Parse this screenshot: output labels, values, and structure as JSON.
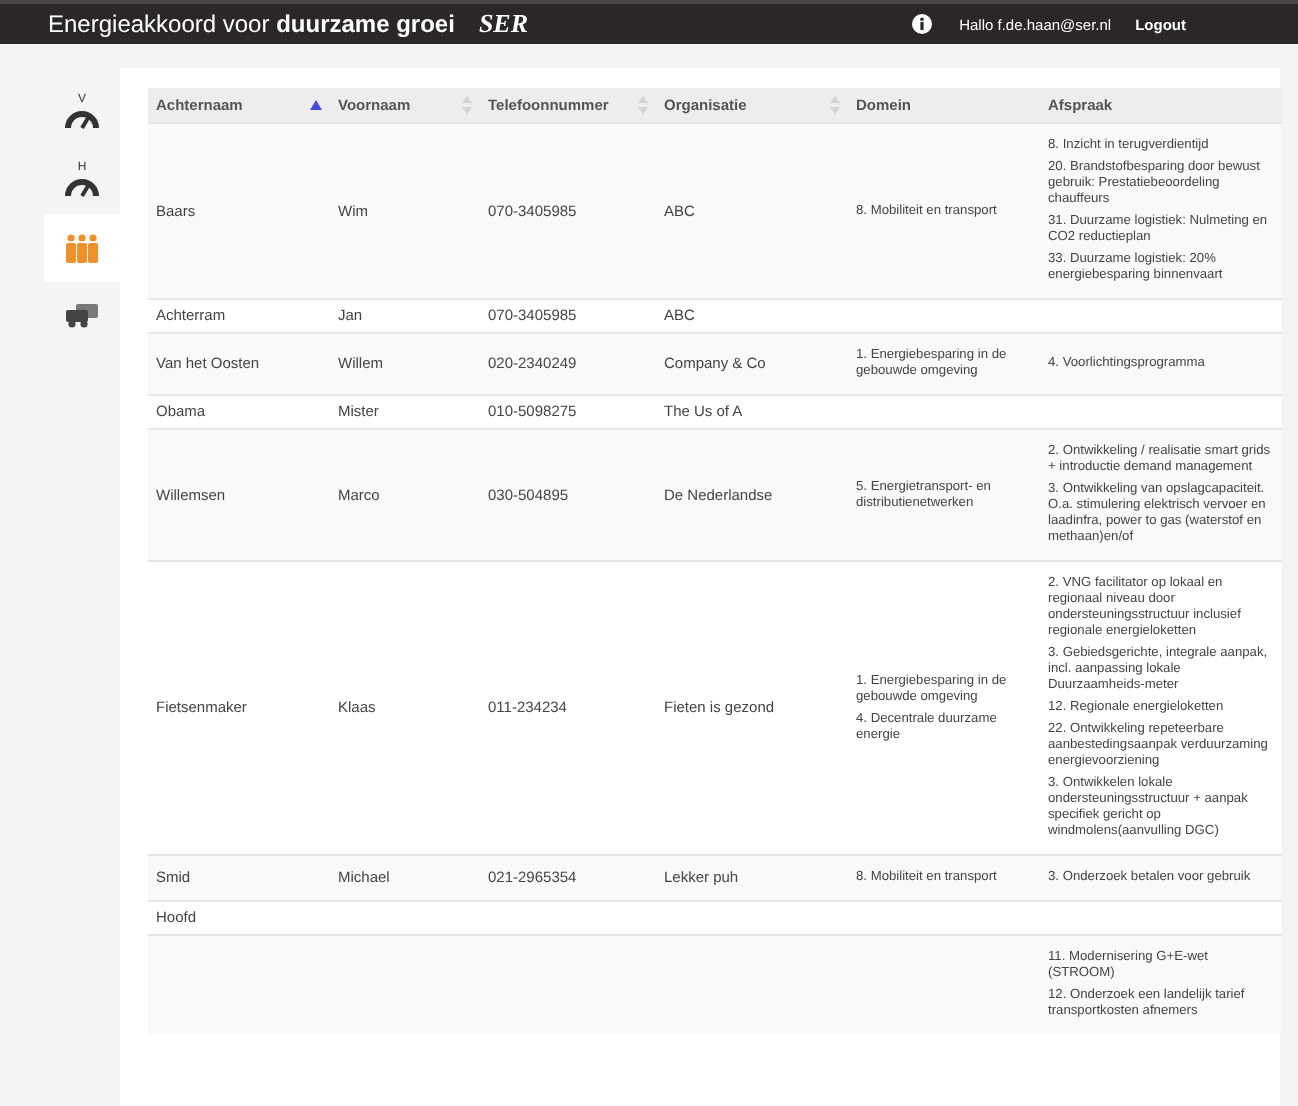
{
  "header": {
    "title_plain": "Energieakkoord voor ",
    "title_bold": "duurzame groei",
    "logo": "SER",
    "greeting": "Hallo f.de.haan@ser.nl",
    "logout": "Logout"
  },
  "sidebar": {
    "items": [
      {
        "kind": "gauge",
        "label": "V",
        "selected": false
      },
      {
        "kind": "gauge",
        "label": "H",
        "selected": false
      },
      {
        "kind": "people",
        "selected": true
      },
      {
        "kind": "vehicles",
        "selected": false
      }
    ]
  },
  "table": {
    "columns": [
      {
        "label": "Achternaam",
        "kind": "ascending"
      },
      {
        "label": "Voornaam",
        "kind": "sortable"
      },
      {
        "label": "Telefoonnummer",
        "kind": "sortable"
      },
      {
        "label": "Organisatie",
        "kind": "sortable"
      },
      {
        "label": "Domein",
        "kind": "plain"
      },
      {
        "label": "Afspraak",
        "kind": "plain"
      }
    ],
    "rows": [
      {
        "achternaam": "Baars",
        "voornaam": "Wim",
        "telefoon": "070-3405985",
        "organisatie": "ABC",
        "domein": [
          "8. Mobiliteit en transport"
        ],
        "afspraak": [
          "8. Inzicht in terugverdientijd",
          "20. Brandstofbesparing door bewust gebruik: Prestatiebeoordeling chauffeurs",
          "31. Duurzame logistiek: Nulmeting en CO2 reductieplan",
          "33. Duurzame logistiek: 20% energiebesparing binnenvaart"
        ]
      },
      {
        "achternaam": "Achterram",
        "voornaam": "Jan",
        "telefoon": "070-3405985",
        "organisatie": "ABC",
        "domein": [],
        "afspraak": []
      },
      {
        "achternaam": "Van het Oosten",
        "voornaam": "Willem",
        "telefoon": "020-2340249",
        "organisatie": "Company & Co",
        "domein": [
          "1. Energiebesparing in de gebouwde omgeving"
        ],
        "afspraak": [
          "4. Voorlichtingsprogramma"
        ]
      },
      {
        "achternaam": "Obama",
        "voornaam": "Mister",
        "telefoon": "010-5098275",
        "organisatie": "The Us of A",
        "domein": [],
        "afspraak": []
      },
      {
        "achternaam": "Willemsen",
        "voornaam": "Marco",
        "telefoon": "030-504895",
        "organisatie": "De Nederlandse",
        "domein": [
          "5. Energietransport- en distributienetwerken"
        ],
        "afspraak": [
          "2. Ontwikkeling / realisatie smart grids + introductie demand management",
          "3. Ontwikkeling van opslagcapaciteit. O.a. stimulering elektrisch vervoer en laadinfra, power to gas (waterstof en methaan)en/of"
        ]
      },
      {
        "achternaam": "Fietsenmaker",
        "voornaam": "Klaas",
        "telefoon": "011-234234",
        "organisatie": "Fieten is gezond",
        "domein": [
          "1. Energiebesparing in de gebouwde omgeving",
          "4. Decentrale duurzame energie"
        ],
        "afspraak": [
          "2. VNG facilitator op lokaal en regionaal niveau door ondersteuningsstructuur inclusief regionale energieloketten",
          "3. Gebiedsgerichte, integrale aanpak, incl. aanpassing lokale Duurzaamheids-meter",
          "12. Regionale energieloketten",
          "22. Ontwikkeling repeteerbare aanbestedingsaanpak verduurzaming energievoorziening",
          "3. Ontwikkelen lokale ondersteuningsstructuur + aanpak specifiek gericht op windmolens(aanvulling DGC)"
        ]
      },
      {
        "achternaam": "Smid",
        "voornaam": "Michael",
        "telefoon": "021-2965354",
        "organisatie": "Lekker puh",
        "domein": [
          "8. Mobiliteit en transport"
        ],
        "afspraak": [
          "3. Onderzoek betalen voor gebruik"
        ]
      },
      {
        "achternaam": "Hoofd",
        "voornaam": "",
        "telefoon": "",
        "organisatie": "",
        "domein": [],
        "afspraak": []
      },
      {
        "achternaam": "",
        "voornaam": "",
        "telefoon": "",
        "organisatie": "",
        "domein": [],
        "afspraak": [
          "11. Modernisering G+E-wet (STROOM)",
          "12. Onderzoek een landelijk tarief transportkosten afnemers"
        ]
      }
    ]
  }
}
